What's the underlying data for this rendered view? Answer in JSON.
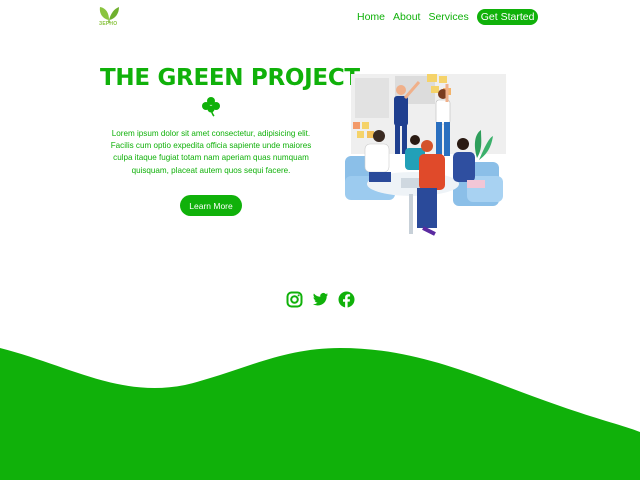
{
  "logo": {
    "text": "ЗЕРНО",
    "icon": "leaf-logo-icon"
  },
  "nav": {
    "items": [
      "Home",
      "About",
      "Services"
    ],
    "cta": "Get Started"
  },
  "hero": {
    "title": "THE GREEN PROJECT",
    "icon": "clover-icon",
    "lines": [
      "Lorem ipsum dolor sit amet consectetur, adipisicing elit.",
      "Facilis cum optio expedita officia sapiente unde maiores",
      "culpa itaque fugiat totam nam aperiam quas numquam",
      "quisquam, placeat autem quos sequi facere."
    ],
    "button": "Learn More",
    "illustration": "team-collaboration-illustration"
  },
  "social": [
    "instagram-icon",
    "twitter-icon",
    "facebook-icon"
  ],
  "colors": {
    "accent": "#10b10a",
    "logo": "#8ac43f",
    "background": "#ffffff"
  }
}
